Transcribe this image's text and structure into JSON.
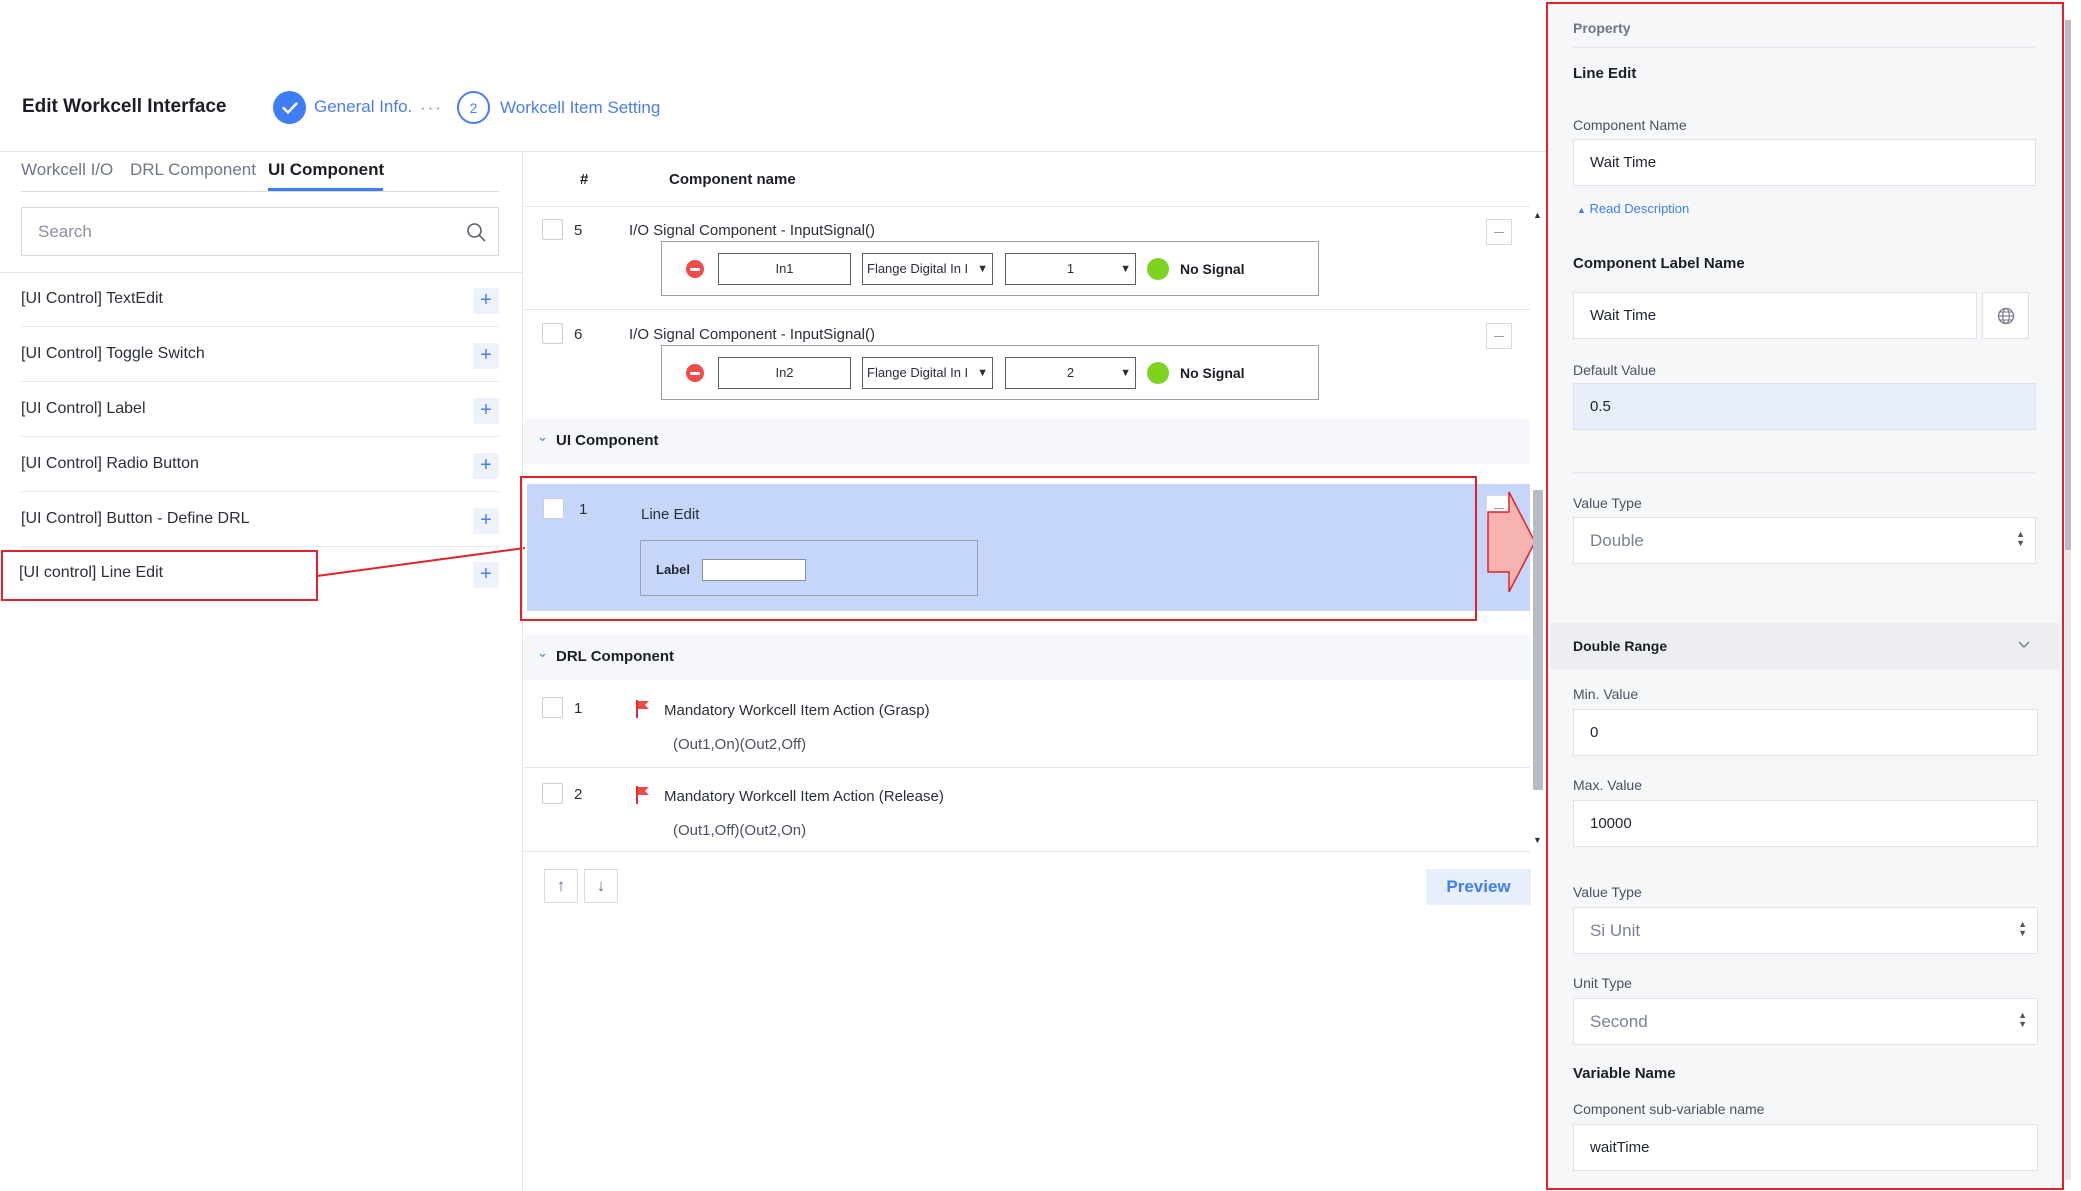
{
  "header": {
    "title": "Edit Workcell Interface",
    "steps": [
      {
        "label": "General Info.",
        "state": "done"
      },
      {
        "number": "2",
        "label": "Workcell Item Setting",
        "state": "current"
      }
    ],
    "dots": "···"
  },
  "left": {
    "tabs": [
      {
        "label": "Workcell I/O"
      },
      {
        "label": "DRL Component"
      },
      {
        "label": "UI Component",
        "active": true
      }
    ],
    "search": {
      "placeholder": "Search"
    },
    "items": [
      {
        "label": "[UI Control] TextEdit"
      },
      {
        "label": "[UI Control] Toggle Switch"
      },
      {
        "label": "[UI Control] Label"
      },
      {
        "label": "[UI Control] Radio Button"
      },
      {
        "label": "[UI Control] Button - Define DRL"
      },
      {
        "label": "[UI control] Line Edit"
      }
    ],
    "plus": "+"
  },
  "table": {
    "col_index": "#",
    "col_name": "Component name",
    "io_rows": [
      {
        "num": "5",
        "title": "I/O Signal Component - InputSignal()",
        "input": "In1",
        "select1": "Flange Digital In I",
        "select2": "1",
        "status": "No Signal"
      },
      {
        "num": "6",
        "title": "I/O Signal Component - InputSignal()",
        "input": "In2",
        "select1": "Flange Digital In I",
        "select2": "2",
        "status": "No Signal"
      }
    ],
    "ui_section": "UI Component",
    "ui_row": {
      "num": "1",
      "title": "Line Edit",
      "label": "Label"
    },
    "drl_section": "DRL Component",
    "drl_rows": [
      {
        "num": "1",
        "title": "Mandatory Workcell Item Action (Grasp)",
        "sub": "(Out1,On)(Out2,Off)"
      },
      {
        "num": "2",
        "title": "Mandatory Workcell Item Action (Release)",
        "sub": "(Out1,Off)(Out2,On)"
      }
    ],
    "up_arrow": "↑",
    "down_arrow": "↓",
    "preview": "Preview"
  },
  "property": {
    "title": "Property",
    "component_type": "Line Edit",
    "component_name_label": "Component Name",
    "component_name": "Wait Time",
    "read_description": "Read Description",
    "label_name_heading": "Component Label Name",
    "label_name": "Wait Time",
    "default_value_label": "Default Value",
    "default_value": "0.5",
    "value_type_label": "Value Type",
    "value_type": "Double",
    "double_range": "Double Range",
    "min_label": "Min. Value",
    "min_value": "0",
    "max_label": "Max. Value",
    "max_value": "10000",
    "value_type2_label": "Value Type",
    "value_type2": "Si Unit",
    "unit_type_label": "Unit Type",
    "unit_type": "Second",
    "variable_heading": "Variable Name",
    "sub_var_label": "Component sub-variable name",
    "sub_var": "waitTime"
  },
  "colors": {
    "accent": "#3d7ef5",
    "highlight": "#e0232a",
    "selected_row": "#c6d6fb",
    "signal_ok": "#7ed321",
    "remove": "#f04a4a"
  }
}
